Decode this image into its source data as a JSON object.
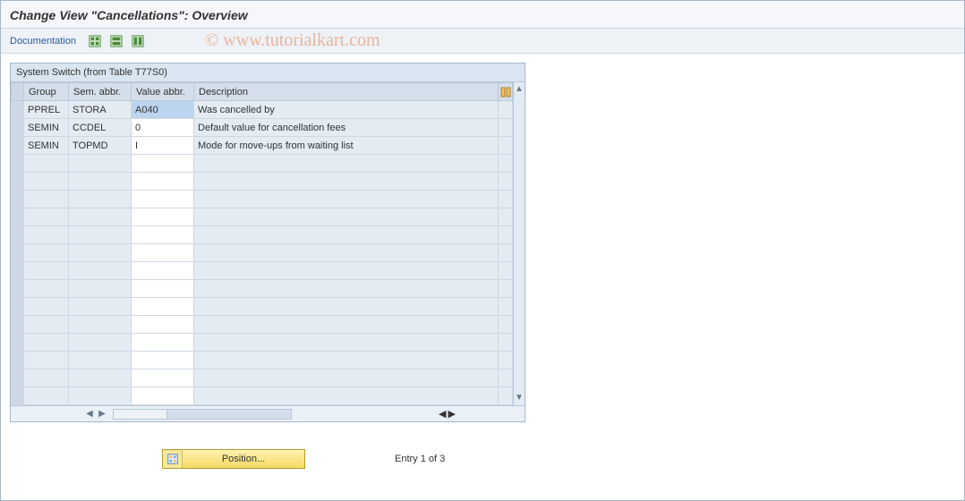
{
  "title": "Change View \"Cancellations\": Overview",
  "watermark": "© www.tutorialkart.com",
  "toolbar": {
    "documentation_label": "Documentation"
  },
  "panel": {
    "caption": "System Switch (from Table T77S0)",
    "columns": {
      "group": "Group",
      "sem": "Sem. abbr.",
      "val": "Value abbr.",
      "desc": "Description"
    },
    "rows": [
      {
        "group": "PPREL",
        "sem": "STORA",
        "val": "A040",
        "desc": "Was cancelled by",
        "selected": true
      },
      {
        "group": "SEMIN",
        "sem": "CCDEL",
        "val": "0",
        "desc": "Default value for cancellation fees"
      },
      {
        "group": "SEMIN",
        "sem": "TOPMD",
        "val": "I",
        "desc": "Mode for move-ups from waiting list"
      }
    ],
    "empty_rows": 14
  },
  "footer": {
    "position_label": "Position...",
    "entry_text": "Entry 1 of 3"
  }
}
